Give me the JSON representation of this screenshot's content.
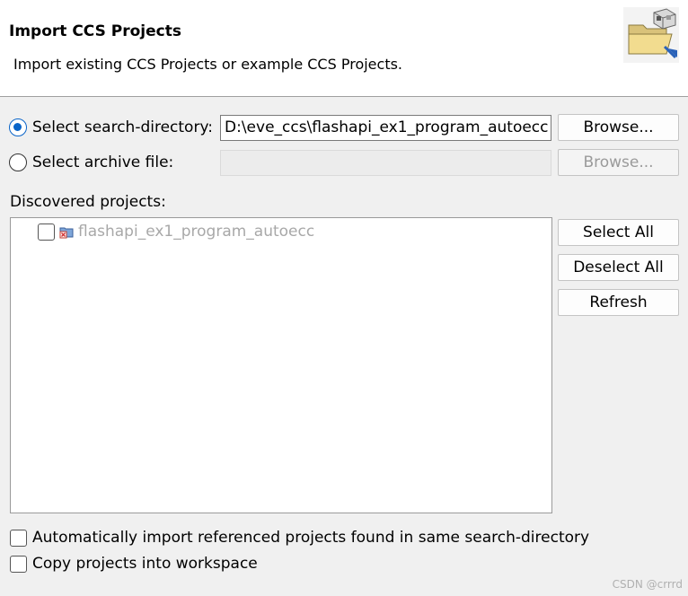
{
  "header": {
    "title": "Import CCS Projects",
    "description": "Import existing CCS Projects or example CCS Projects."
  },
  "search_directory": {
    "label": "Select search-directory:",
    "value": "D:\\eve_ccs\\flashapi_ex1_program_autoecc",
    "checked": true,
    "browse_label": "Browse..."
  },
  "archive_file": {
    "label": "Select archive file:",
    "value": "",
    "checked": false,
    "browse_label": "Browse..."
  },
  "discovered": {
    "label": "Discovered projects:",
    "projects": [
      {
        "name": "flashapi_ex1_program_autoecc",
        "checked": false,
        "icon": "ccs-project-error-icon"
      }
    ],
    "select_all_label": "Select All",
    "deselect_all_label": "Deselect All",
    "refresh_label": "Refresh"
  },
  "options": {
    "auto_import_label": "Automatically import referenced projects found in same search-directory",
    "copy_label": "Copy projects into workspace"
  },
  "watermark": "CSDN @crrrd",
  "colors": {
    "radio_accent": "#0a64c8",
    "disabled_text": "#a8a8a8",
    "header_bg": "#ffffff",
    "body_bg": "#f0f0f0"
  }
}
